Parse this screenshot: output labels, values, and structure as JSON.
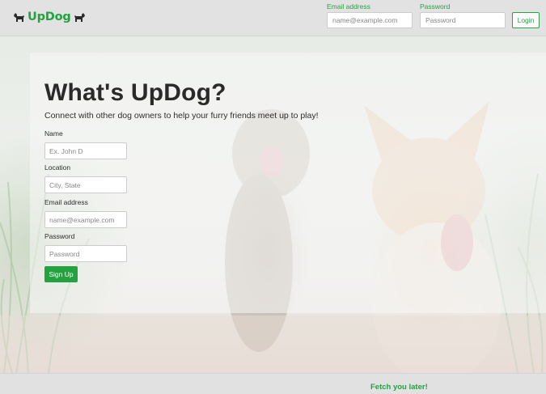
{
  "brand": {
    "name": "UpDog",
    "icon": "dog-icon",
    "color": "#22a340"
  },
  "nav": {
    "email_label": "Email address",
    "email_placeholder": "name@example.com",
    "password_label": "Password",
    "password_placeholder": "Password",
    "login_label": "Login"
  },
  "hero": {
    "title": "What's UpDog?",
    "lead": "Connect with other dog owners to help your furry friends meet up to play!"
  },
  "signup_form": {
    "name_label": "Name",
    "name_placeholder": "Ex. John D",
    "location_label": "Location",
    "location_placeholder": "City, State",
    "email_label": "Email address",
    "email_placeholder": "name@example.com",
    "password_label": "Password",
    "password_placeholder": "Password",
    "submit_label": "Sign Up"
  },
  "footer": {
    "text": "Fetch you later!"
  }
}
